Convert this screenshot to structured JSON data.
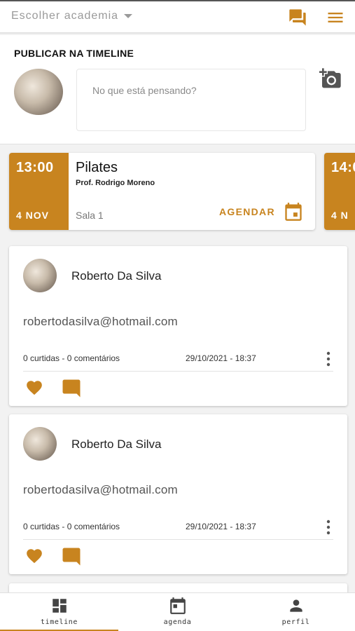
{
  "colors": {
    "accent": "#c8841f",
    "background": "#f2f2f2",
    "card": "#ffffff"
  },
  "header": {
    "gym_select": "Escolher academia",
    "icons": [
      "chat-icon",
      "menu-icon"
    ]
  },
  "publish": {
    "title": "PUBLICAR NA TIMELINE",
    "placeholder": "No que está pensando?",
    "photo_icon": "add-photo-icon"
  },
  "classes": [
    {
      "time": "13:00",
      "date": "4 NOV",
      "name": "Pilates",
      "teacher": "Prof. Rodrigo Moreno",
      "room": "Sala 1",
      "action": "AGENDAR"
    },
    {
      "time": "14:0",
      "date": "4 N"
    }
  ],
  "posts": [
    {
      "author": "Roberto Da Silva",
      "text": "robertodasilva@hotmail.com",
      "stats": "0 curtidas  - 0 comentários",
      "date": "29/10/2021 - 18:37"
    },
    {
      "author": "Roberto Da Silva",
      "text": "robertodasilva@hotmail.com",
      "stats": "0 curtidas  - 0 comentários",
      "date": "29/10/2021 - 18:37"
    }
  ],
  "nav": {
    "items": [
      {
        "label": "timeline",
        "icon": "dashboard-icon",
        "active": true
      },
      {
        "label": "agenda",
        "icon": "calendar-icon",
        "active": false
      },
      {
        "label": "perfil",
        "icon": "person-icon",
        "active": false
      }
    ]
  }
}
